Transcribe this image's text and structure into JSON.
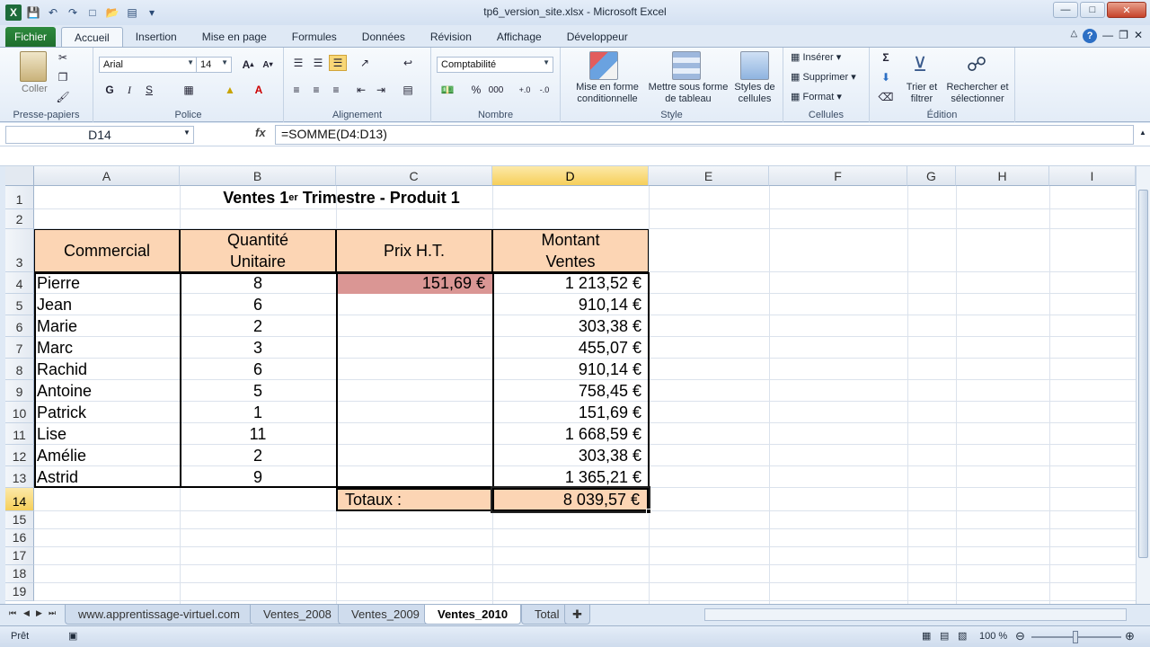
{
  "window": {
    "title": "tp6_version_site.xlsx - Microsoft Excel",
    "qat_icons": [
      "excel-logo",
      "save-icon",
      "undo-icon",
      "redo-icon",
      "new-icon",
      "open-icon",
      "print-preview-icon"
    ]
  },
  "tabs": [
    {
      "label": "Fichier",
      "key": "file"
    },
    {
      "label": "Accueil",
      "key": "home"
    },
    {
      "label": "Insertion",
      "key": "insert"
    },
    {
      "label": "Mise en page",
      "key": "layout"
    },
    {
      "label": "Formules",
      "key": "formulas"
    },
    {
      "label": "Données",
      "key": "data"
    },
    {
      "label": "Révision",
      "key": "review"
    },
    {
      "label": "Affichage",
      "key": "view"
    },
    {
      "label": "Développeur",
      "key": "developer"
    }
  ],
  "active_tab": "Accueil",
  "ribbon": {
    "clipboard": {
      "label": "Presse-papiers",
      "paste": "Coller"
    },
    "font": {
      "label": "Police",
      "name": "Arial",
      "size": "14",
      "bold": "G",
      "italic": "I",
      "underline": "S"
    },
    "alignment": {
      "label": "Alignement"
    },
    "number": {
      "label": "Nombre",
      "format": "Comptabilité",
      "percent": "%",
      "thousands": "000"
    },
    "style": {
      "label": "Style",
      "conditional": "Mise en forme conditionnelle",
      "table": "Mettre sous forme de tableau",
      "cell_styles": "Styles de cellules"
    },
    "cells": {
      "label": "Cellules",
      "insert": "Insérer",
      "delete": "Supprimer",
      "format": "Format"
    },
    "editing": {
      "label": "Édition",
      "sort": "Trier et filtrer",
      "find": "Rechercher et sélectionner"
    }
  },
  "formula_bar": {
    "name_box": "D14",
    "fx": "fx",
    "formula": "=SOMME(D4:D13)"
  },
  "columns": [
    "A",
    "B",
    "C",
    "D",
    "E",
    "F",
    "G",
    "H",
    "I"
  ],
  "selected_column": "D",
  "rows": [
    "1",
    "2",
    "3",
    "4",
    "5",
    "6",
    "7",
    "8",
    "9",
    "10",
    "11",
    "12",
    "13",
    "14",
    "15",
    "16",
    "17",
    "18",
    "19"
  ],
  "selected_row": "14",
  "sheet": {
    "title_pre": "Ventes 1",
    "title_sup": "er",
    "title_post": " Trimestre - Produit 1",
    "headers": {
      "commercial": "Commercial",
      "qty_line1": "Quantité",
      "qty_line2": "Unitaire",
      "price": "Prix H.T.",
      "amount_line1": "Montant",
      "amount_line2": "Ventes"
    },
    "price_value": "151,69 €",
    "data": [
      {
        "name": "Pierre",
        "qty": "8",
        "amount": "1 213,52 €"
      },
      {
        "name": "Jean",
        "qty": "6",
        "amount": "910,14 €"
      },
      {
        "name": "Marie",
        "qty": "2",
        "amount": "303,38 €"
      },
      {
        "name": "Marc",
        "qty": "3",
        "amount": "455,07 €"
      },
      {
        "name": "Rachid",
        "qty": "6",
        "amount": "910,14 €"
      },
      {
        "name": "Antoine",
        "qty": "5",
        "amount": "758,45 €"
      },
      {
        "name": "Patrick",
        "qty": "1",
        "amount": "151,69 €"
      },
      {
        "name": "Lise",
        "qty": "11",
        "amount": "1 668,59 €"
      },
      {
        "name": "Amélie",
        "qty": "2",
        "amount": "303,38 €"
      },
      {
        "name": "Astrid",
        "qty": "9",
        "amount": "1 365,21 €"
      }
    ],
    "totals_label": "Totaux :",
    "totals_value": "8 039,57 €"
  },
  "sheet_tabs": [
    {
      "label": "www.apprentissage-virtuel.com"
    },
    {
      "label": "Ventes_2008"
    },
    {
      "label": "Ventes_2009"
    },
    {
      "label": "Ventes_2010"
    },
    {
      "label": "Total"
    }
  ],
  "active_sheet": "Ventes_2010",
  "status": {
    "ready": "Prêt",
    "zoom": "100 %"
  },
  "colors": {
    "header_fill": "#fcd5b4",
    "price_fill": "#da9694",
    "selection": "#f6cf5a"
  }
}
